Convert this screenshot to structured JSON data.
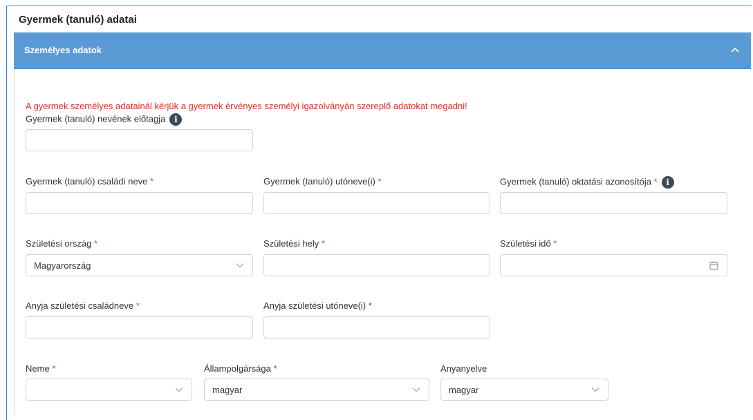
{
  "card": {
    "title": "Gyermek (tanuló) adatai"
  },
  "panel": {
    "title": "Személyes adatok",
    "toggle_icon": "chevron-up-icon"
  },
  "warning": "A gyermek személyes adatainál kérjük a gyermek érvényes személyi igazolványán szereplő adatokat megadni!",
  "fields": {
    "name_prefix": {
      "label": "Gyermek (tanuló) nevének előtagja",
      "value": "",
      "info": "i"
    },
    "family_name": {
      "label": "Gyermek (tanuló) családi neve",
      "required": "*",
      "value": ""
    },
    "given_name": {
      "label": "Gyermek (tanuló) utóneve(i)",
      "required": "*",
      "value": ""
    },
    "edu_id": {
      "label": "Gyermek (tanuló) oktatási azonosítója",
      "required": "*",
      "value": "",
      "info": "i"
    },
    "birth_country": {
      "label": "Születési ország",
      "required": "*",
      "value": "Magyarország"
    },
    "birth_place": {
      "label": "Születési hely",
      "required": "*",
      "value": ""
    },
    "birth_date": {
      "label": "Születési idő",
      "required": "*",
      "value": ""
    },
    "mother_family": {
      "label": "Anyja születési családneve",
      "required": "*",
      "value": ""
    },
    "mother_given": {
      "label": "Anyja születési utóneve(i)",
      "required": "*",
      "value": ""
    },
    "gender": {
      "label": "Neme",
      "required": "*",
      "value": ""
    },
    "citizenship": {
      "label": "Állampolgársága",
      "required": "*",
      "value": "magyar"
    },
    "mother_tongue": {
      "label": "Anyanyelve",
      "value": "magyar"
    }
  },
  "colors": {
    "panel_header": "#5b9bd5",
    "warning": "#d62d20",
    "required": "#e04646",
    "frame": "#3b82d6"
  }
}
